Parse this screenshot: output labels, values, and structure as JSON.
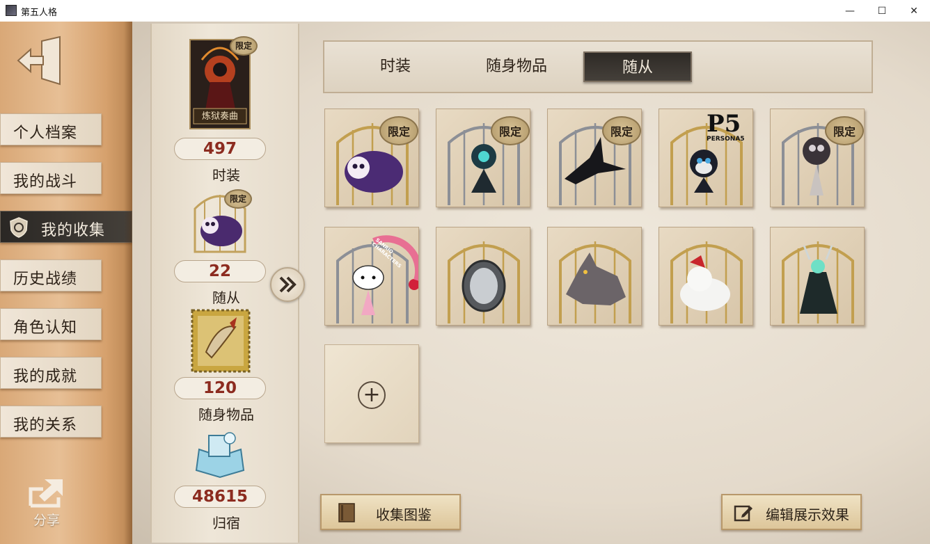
{
  "window": {
    "title": "第五人格"
  },
  "sidebar": {
    "items": [
      {
        "label": "个人档案"
      },
      {
        "label": "我的战斗"
      },
      {
        "label": "我的收集"
      },
      {
        "label": "历史战绩"
      },
      {
        "label": "角色认知"
      },
      {
        "label": "我的成就"
      },
      {
        "label": "我的关系"
      }
    ],
    "active_index": 2,
    "share_label": "分享"
  },
  "summary": {
    "costume": {
      "card_label": "炼狱奏曲",
      "badge": "限定",
      "count": "497",
      "label": "时装"
    },
    "pet": {
      "badge": "限定",
      "count": "22",
      "label": "随从"
    },
    "accessory": {
      "count": "120",
      "label": "随身物品"
    },
    "dorm": {
      "count": "48615",
      "label": "归宿"
    }
  },
  "tabs": [
    {
      "label": "时装",
      "active": false
    },
    {
      "label": "随身物品",
      "active": false
    },
    {
      "label": "随从",
      "active": true
    }
  ],
  "grid": {
    "items": [
      {
        "name": "purple-sheep-pet",
        "cage": "gold",
        "badge": "限定"
      },
      {
        "name": "teal-flower-pet",
        "cage": "silver",
        "badge": "限定"
      },
      {
        "name": "black-dragon-pet",
        "cage": "silver",
        "badge": "限定"
      },
      {
        "name": "morgana-cat-pet",
        "cage": "gold",
        "badge": "",
        "logo": "P5",
        "logo_sub": "PERSONA5"
      },
      {
        "name": "dark-shadow-pet",
        "cage": "silver",
        "badge": "限定"
      },
      {
        "name": "hello-kitty-pet",
        "cage": "silver",
        "badge": "",
        "ribbon": "SANRIO CHARACTERS"
      },
      {
        "name": "mirror-pet",
        "cage": "gold",
        "badge": ""
      },
      {
        "name": "gray-wolf-pet",
        "cage": "gold",
        "badge": ""
      },
      {
        "name": "white-fox-pet",
        "cage": "gold",
        "badge": ""
      },
      {
        "name": "green-antler-pet",
        "cage": "gold",
        "badge": ""
      }
    ],
    "add_label": "+"
  },
  "buttons": {
    "encyclopedia": "收集图鉴",
    "edit_display": "编辑展示效果"
  },
  "colors": {
    "sidebar_bg": "#e0b284",
    "nav_active_bg": "#2e2a26",
    "count_text": "#8c2b1f",
    "paper_bg": "#e9e1d3"
  }
}
